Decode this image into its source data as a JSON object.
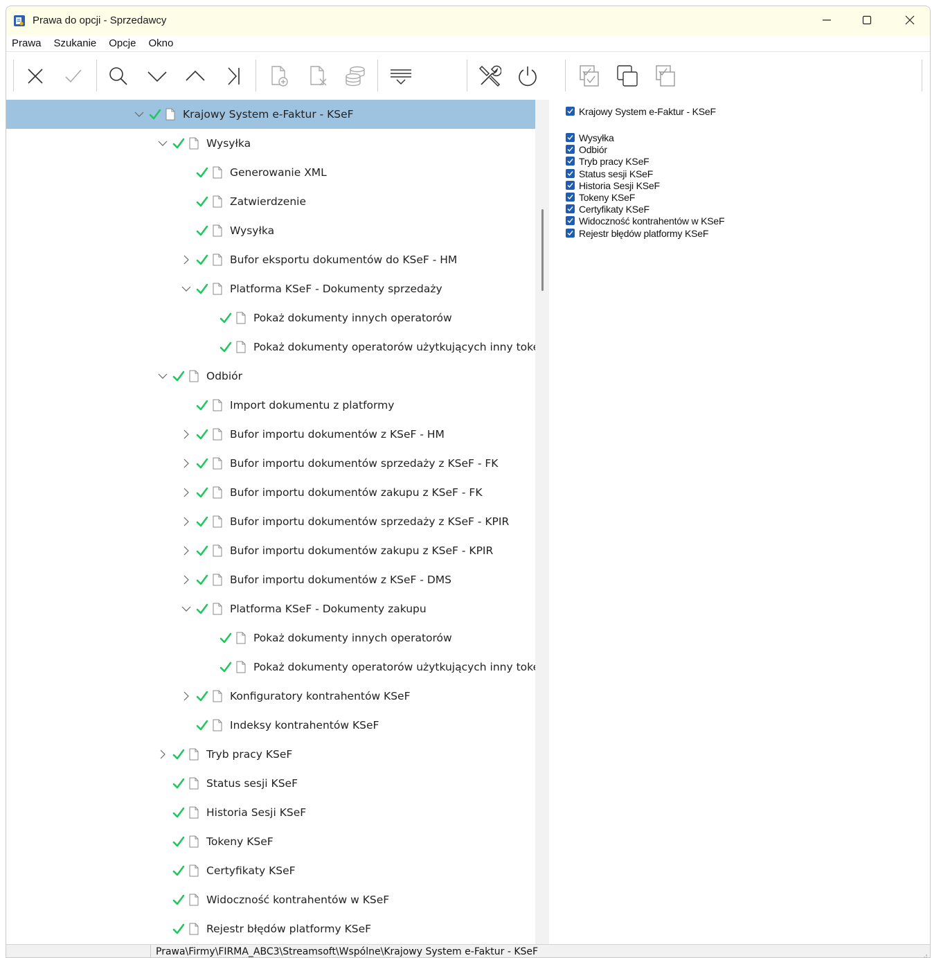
{
  "window": {
    "title": "Prawa do opcji - Sprzedawcy",
    "minimize_icon": "minimize-icon",
    "maximize_icon": "maximize-icon",
    "close_icon": "close-icon"
  },
  "menu": [
    "Prawa",
    "Szukanie",
    "Opcje",
    "Okno"
  ],
  "toolbar": [
    {
      "name": "cancel-button",
      "icon": "x-icon"
    },
    {
      "name": "accept-button",
      "icon": "check-icon"
    },
    {
      "name": "search-button",
      "icon": "search-icon"
    },
    {
      "name": "next-button",
      "icon": "chevron-down-icon"
    },
    {
      "name": "previous-button",
      "icon": "chevron-up-icon"
    },
    {
      "name": "last-button",
      "icon": "skip-last-icon"
    },
    {
      "name": "add-document-button",
      "icon": "document-add-icon"
    },
    {
      "name": "delete-document-button",
      "icon": "document-delete-icon"
    },
    {
      "name": "database-button",
      "icon": "database-icon"
    },
    {
      "name": "filter-button",
      "icon": "filter-icon"
    },
    {
      "name": "tools-button",
      "icon": "tools-icon"
    },
    {
      "name": "power-button",
      "icon": "power-icon"
    },
    {
      "name": "check-all-button",
      "icon": "check-all-icon"
    },
    {
      "name": "uncheck-all-button",
      "icon": "uncheck-all-icon"
    },
    {
      "name": "invert-check-button",
      "icon": "invert-check-icon"
    }
  ],
  "tree": [
    {
      "label": "Krajowy System e-Faktur - KSeF",
      "level": 0,
      "expander": "expanded",
      "selected": true
    },
    {
      "label": "Wysyłka",
      "level": 1,
      "expander": "expanded"
    },
    {
      "label": "Generowanie XML",
      "level": 2,
      "expander": "none"
    },
    {
      "label": "Zatwierdzenie",
      "level": 2,
      "expander": "none"
    },
    {
      "label": "Wysyłka",
      "level": 2,
      "expander": "none"
    },
    {
      "label": "Bufor eksportu dokumentów do KSeF - HM",
      "level": 2,
      "expander": "collapsed"
    },
    {
      "label": "Platforma KSeF - Dokumenty sprzedaży",
      "level": 2,
      "expander": "expanded"
    },
    {
      "label": "Pokaż dokumenty innych operatorów",
      "level": 3,
      "expander": "none"
    },
    {
      "label": "Pokaż dokumenty operatorów użytkujących inny toke..",
      "level": 3,
      "expander": "none"
    },
    {
      "label": "Odbiór",
      "level": 1,
      "expander": "expanded"
    },
    {
      "label": "Import dokumentu z platformy",
      "level": 2,
      "expander": "none"
    },
    {
      "label": "Bufor importu dokumentów z KSeF - HM",
      "level": 2,
      "expander": "collapsed"
    },
    {
      "label": "Bufor importu dokumentów sprzedaży z KSeF - FK",
      "level": 2,
      "expander": "collapsed"
    },
    {
      "label": "Bufor importu dokumentów zakupu z KSeF - FK",
      "level": 2,
      "expander": "collapsed"
    },
    {
      "label": "Bufor importu dokumentów sprzedaży z KSeF - KPIR",
      "level": 2,
      "expander": "collapsed"
    },
    {
      "label": "Bufor importu dokumentów zakupu z KSeF - KPIR",
      "level": 2,
      "expander": "collapsed"
    },
    {
      "label": "Bufor importu dokumentów z KSeF - DMS",
      "level": 2,
      "expander": "collapsed"
    },
    {
      "label": "Platforma KSeF - Dokumenty zakupu",
      "level": 2,
      "expander": "expanded"
    },
    {
      "label": "Pokaż dokumenty innych operatorów",
      "level": 3,
      "expander": "none"
    },
    {
      "label": "Pokaż dokumenty operatorów użytkujących inny toke..",
      "level": 3,
      "expander": "none"
    },
    {
      "label": "Konfiguratory kontrahentów KSeF",
      "level": 2,
      "expander": "collapsed"
    },
    {
      "label": "Indeksy kontrahentów KSeF",
      "level": 2,
      "expander": "none"
    },
    {
      "label": "Tryb pracy KSeF",
      "level": 1,
      "expander": "collapsed"
    },
    {
      "label": "Status sesji KSeF",
      "level": 1,
      "expander": "none"
    },
    {
      "label": "Historia Sesji KSeF",
      "level": 1,
      "expander": "none"
    },
    {
      "label": "Tokeny KSeF",
      "level": 1,
      "expander": "none"
    },
    {
      "label": "Certyfikaty KSeF",
      "level": 1,
      "expander": "none"
    },
    {
      "label": "Widoczność kontrahentów w KSeF",
      "level": 1,
      "expander": "none"
    },
    {
      "label": "Rejestr błędów platformy KSeF",
      "level": 1,
      "expander": "none"
    }
  ],
  "right_panel": {
    "root": {
      "label": "Krajowy System e-Faktur - KSeF",
      "checked": true
    },
    "items": [
      {
        "label": "Wysyłka",
        "checked": true
      },
      {
        "label": "Odbiór",
        "checked": true
      },
      {
        "label": "Tryb pracy KSeF",
        "checked": true
      },
      {
        "label": "Status sesji KSeF",
        "checked": true
      },
      {
        "label": "Historia Sesji KSeF",
        "checked": true
      },
      {
        "label": "Tokeny KSeF",
        "checked": true
      },
      {
        "label": "Certyfikaty KSeF",
        "checked": true
      },
      {
        "label": "Widoczność kontrahentów w KSeF",
        "checked": true
      },
      {
        "label": "Rejestr błędów platformy KSeF",
        "checked": true
      }
    ]
  },
  "status": {
    "path": "Prawa\\Firmy\\FIRMA_ABC3\\Streamsoft\\Wspólne\\Krajowy System e-Faktur - KSeF"
  },
  "colors": {
    "selection": "#9ec3e0",
    "check": "#22c55e",
    "checkbox": "#1e5db3",
    "titlebar": "#fdfde8"
  }
}
